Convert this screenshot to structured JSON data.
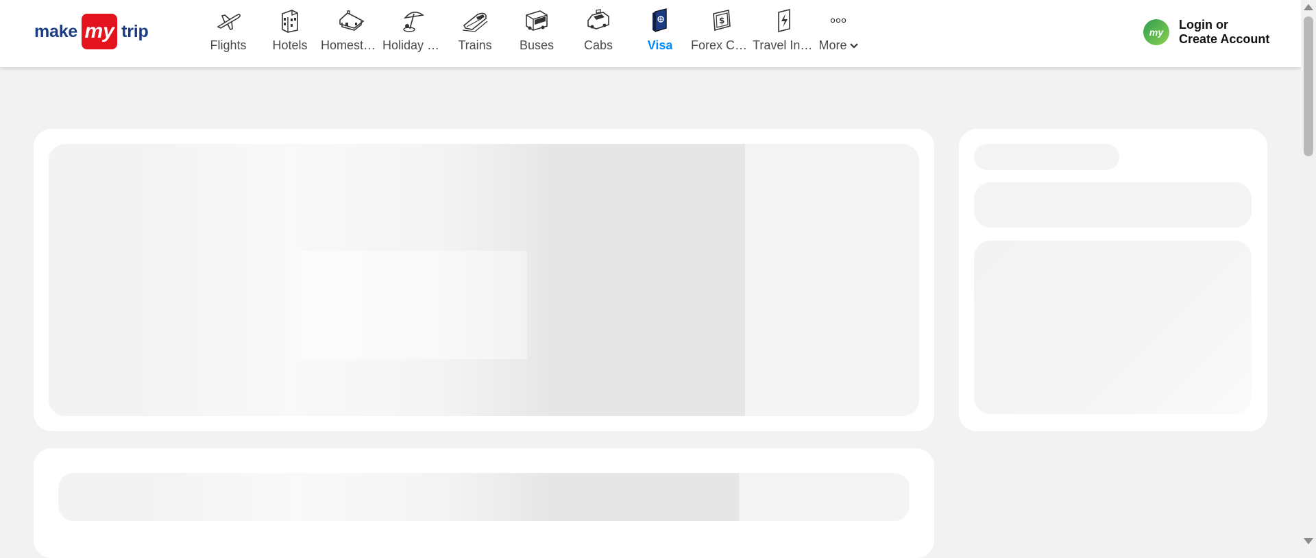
{
  "brand": {
    "left": "make",
    "badge": "my",
    "right": "trip"
  },
  "nav": [
    {
      "label": "Flights",
      "icon": "flight-icon",
      "active": false
    },
    {
      "label": "Hotels",
      "icon": "hotel-icon",
      "active": false
    },
    {
      "label": "Homestays",
      "icon": "homestay-icon",
      "active": false
    },
    {
      "label": "Holiday Packages",
      "icon": "holiday-icon",
      "active": false
    },
    {
      "label": "Trains",
      "icon": "train-icon",
      "active": false
    },
    {
      "label": "Buses",
      "icon": "bus-icon",
      "active": false
    },
    {
      "label": "Cabs",
      "icon": "cab-icon",
      "active": false
    },
    {
      "label": "Visa",
      "icon": "visa-icon",
      "active": true
    },
    {
      "label": "Forex Card",
      "icon": "forex-icon",
      "active": false
    },
    {
      "label": "Travel Insurance",
      "icon": "insurance-icon",
      "active": false
    }
  ],
  "more": {
    "label": "More",
    "icon": "more-icon"
  },
  "login": {
    "avatar": "my",
    "line1": "Login or",
    "line2": "Create Account"
  },
  "colors": {
    "active": "#008cff",
    "brand_red": "#e4141e",
    "brand_blue": "#1b3b82",
    "page_bg": "#f2f2f2"
  }
}
